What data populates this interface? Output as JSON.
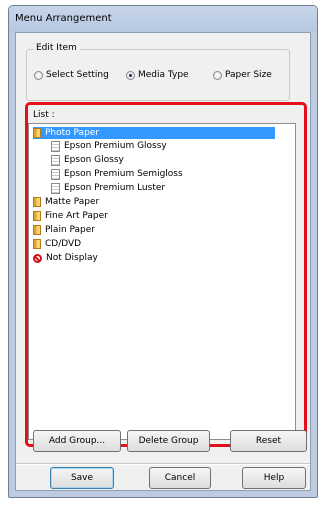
{
  "window": {
    "title": "Menu Arrangement"
  },
  "edit_item": {
    "label": "Edit Item",
    "options": [
      {
        "label": "Select Setting",
        "checked": false
      },
      {
        "label": "Media Type",
        "checked": true
      },
      {
        "label": "Paper Size",
        "checked": false
      }
    ]
  },
  "list": {
    "label": "List :",
    "items": [
      {
        "label": "Photo Paper",
        "icon": "folder-icon",
        "selected": true
      },
      {
        "label": "Epson Premium Glossy",
        "icon": "document-icon"
      },
      {
        "label": "Epson Glossy",
        "icon": "document-icon"
      },
      {
        "label": "Epson Premium Semigloss",
        "icon": "document-icon"
      },
      {
        "label": "Epson Premium Luster",
        "icon": "document-icon"
      },
      {
        "label": "Matte Paper",
        "icon": "folder-icon"
      },
      {
        "label": "Fine Art Paper",
        "icon": "folder-icon"
      },
      {
        "label": "Plain Paper",
        "icon": "folder-icon"
      },
      {
        "label": "CD/DVD",
        "icon": "folder-icon"
      },
      {
        "label": "Not Display",
        "icon": "no-entry-icon"
      }
    ]
  },
  "buttons": {
    "add_group": "Add Group...",
    "delete_group": "Delete Group",
    "reset": "Reset",
    "save": "Save",
    "cancel": "Cancel",
    "help": "Help"
  },
  "colors": {
    "highlight": "#e0111a",
    "selection": "#3399ff"
  }
}
